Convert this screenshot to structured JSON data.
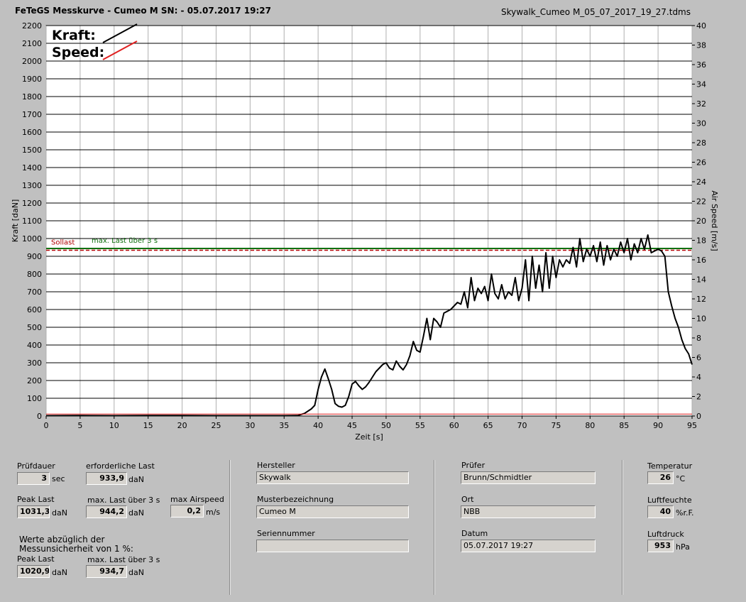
{
  "header": {
    "title": "FeTeGS Messkurve - Cumeo M  SN:  - 05.07.2017 19:27",
    "file": "Skywalk_Cumeo M_05_07_2017_19_27.tdms"
  },
  "chart_data": {
    "type": "line",
    "xlabel": "Zeit [s]",
    "ylabel": "Kraft [daN]",
    "y2label": "Air Speed [m/s]",
    "xlim": [
      0,
      95
    ],
    "ylim": [
      0,
      2200
    ],
    "y2lim": [
      0,
      40
    ],
    "xticks": [
      0,
      5,
      10,
      15,
      20,
      25,
      30,
      35,
      40,
      45,
      50,
      55,
      60,
      65,
      70,
      75,
      80,
      85,
      90,
      95
    ],
    "yticks": [
      0,
      100,
      200,
      300,
      400,
      500,
      600,
      700,
      800,
      900,
      1000,
      1100,
      1200,
      1300,
      1400,
      1500,
      1600,
      1700,
      1800,
      1900,
      2000,
      2100,
      2200
    ],
    "y2ticks": [
      0,
      2,
      4,
      6,
      8,
      10,
      12,
      14,
      16,
      18,
      20,
      22,
      24,
      26,
      28,
      30,
      32,
      34,
      36,
      38,
      40
    ],
    "legend": [
      {
        "label": "Kraft:",
        "color": "#000000"
      },
      {
        "label": "Speed:",
        "color": "#e02020"
      }
    ],
    "reference_lines": [
      {
        "label": "Sollast",
        "value": 933.9,
        "color": "#b00000",
        "style": "dashed"
      },
      {
        "label": "max. Last über  3 s",
        "value": 944.2,
        "color": "#107010",
        "style": "solid"
      }
    ],
    "series": [
      {
        "name": "Kraft",
        "color": "#000000",
        "x": [
          0,
          5,
          10,
          15,
          20,
          25,
          30,
          35,
          37,
          38,
          39,
          39.5,
          40,
          40.5,
          41,
          41.5,
          42,
          42.5,
          43,
          43.5,
          44,
          44.5,
          45,
          45.5,
          46,
          46.5,
          47,
          47.5,
          48,
          48.5,
          49,
          49.5,
          50,
          50.5,
          51,
          51.5,
          52,
          52.5,
          53,
          53.5,
          54,
          54.5,
          55,
          55.5,
          56,
          56.5,
          57,
          57.5,
          58,
          58.5,
          59,
          59.5,
          60,
          60.5,
          61,
          61.5,
          62,
          62.5,
          63,
          63.5,
          64,
          64.5,
          65,
          65.5,
          66,
          66.5,
          67,
          67.5,
          68,
          68.5,
          69,
          69.5,
          70,
          70.5,
          71,
          71.5,
          72,
          72.5,
          73,
          73.5,
          74,
          74.5,
          75,
          75.5,
          76,
          76.5,
          77,
          77.5,
          78,
          78.5,
          79,
          79.5,
          80,
          80.5,
          81,
          81.5,
          82,
          82.5,
          83,
          83.5,
          84,
          84.5,
          85,
          85.5,
          86,
          86.5,
          87,
          87.5,
          88,
          88.5,
          89,
          89.5,
          90,
          90.5,
          91,
          91.5,
          92,
          92.5,
          93,
          93.5,
          94,
          94.5,
          95
        ],
        "y": [
          2,
          3,
          2,
          3,
          3,
          2,
          2,
          2,
          3,
          15,
          40,
          60,
          150,
          220,
          265,
          210,
          150,
          70,
          55,
          50,
          60,
          110,
          180,
          195,
          170,
          150,
          165,
          190,
          220,
          250,
          270,
          290,
          300,
          270,
          260,
          310,
          280,
          260,
          290,
          340,
          420,
          370,
          360,
          450,
          550,
          430,
          550,
          530,
          500,
          580,
          590,
          600,
          620,
          640,
          630,
          700,
          610,
          780,
          650,
          720,
          690,
          730,
          650,
          800,
          690,
          660,
          740,
          660,
          700,
          680,
          780,
          650,
          720,
          880,
          650,
          900,
          720,
          850,
          700,
          920,
          720,
          900,
          780,
          880,
          840,
          880,
          860,
          950,
          840,
          1000,
          870,
          940,
          900,
          960,
          870,
          980,
          850,
          960,
          880,
          940,
          900,
          980,
          920,
          1000,
          880,
          970,
          920,
          1000,
          940,
          1020,
          920,
          930,
          940,
          930,
          900,
          700,
          620,
          550,
          500,
          430,
          380,
          350,
          290
        ]
      },
      {
        "name": "Speed",
        "color": "#e02020",
        "x": [
          0,
          95
        ],
        "y": [
          0.2,
          0.2
        ]
      }
    ]
  },
  "panel": {
    "pruefdauer_label": "Prüfdauer",
    "pruefdauer_value": "3",
    "pruefdauer_unit": "sec",
    "erf_last_label": "erforderliche Last",
    "erf_last_value": "933,9",
    "erf_last_unit": "daN",
    "peak_last_label": "Peak Last",
    "peak_last_value": "1031,3",
    "peak_last_unit": "daN",
    "max_last_label": "max. Last über  3 s",
    "max_last_value": "944,2",
    "max_last_unit": "daN",
    "max_airspeed_label": "max Airspeed",
    "max_airspeed_value": "0,2",
    "max_airspeed_unit": "m/s",
    "note_line1": "Werte abzüglich der",
    "note_line2": "Messunsicherheit von 1  %:",
    "peak_last2_label": "Peak Last",
    "peak_last2_value": "1020,9",
    "peak_last2_unit": "daN",
    "max_last2_label": "max. Last über  3 s",
    "max_last2_value": "934,7",
    "max_last2_unit": "daN",
    "hersteller_label": "Hersteller",
    "hersteller_value": "Skywalk",
    "muster_label": "Musterbezeichnung",
    "muster_value": "Cumeo M",
    "serien_label": "Seriennummer",
    "serien_value": "",
    "pruefer_label": "Prüfer",
    "pruefer_value": "Brunn/Schmidtler",
    "ort_label": "Ort",
    "ort_value": "NBB",
    "datum_label": "Datum",
    "datum_value": "05.07.2017 19:27",
    "temp_label": "Temperatur",
    "temp_value": "26",
    "temp_unit": "°C",
    "feuchte_label": "Luftfeuchte",
    "feuchte_value": "40",
    "feuchte_unit": "%r.F.",
    "druck_label": "Luftdruck",
    "druck_value": "953",
    "druck_unit": "hPa"
  }
}
